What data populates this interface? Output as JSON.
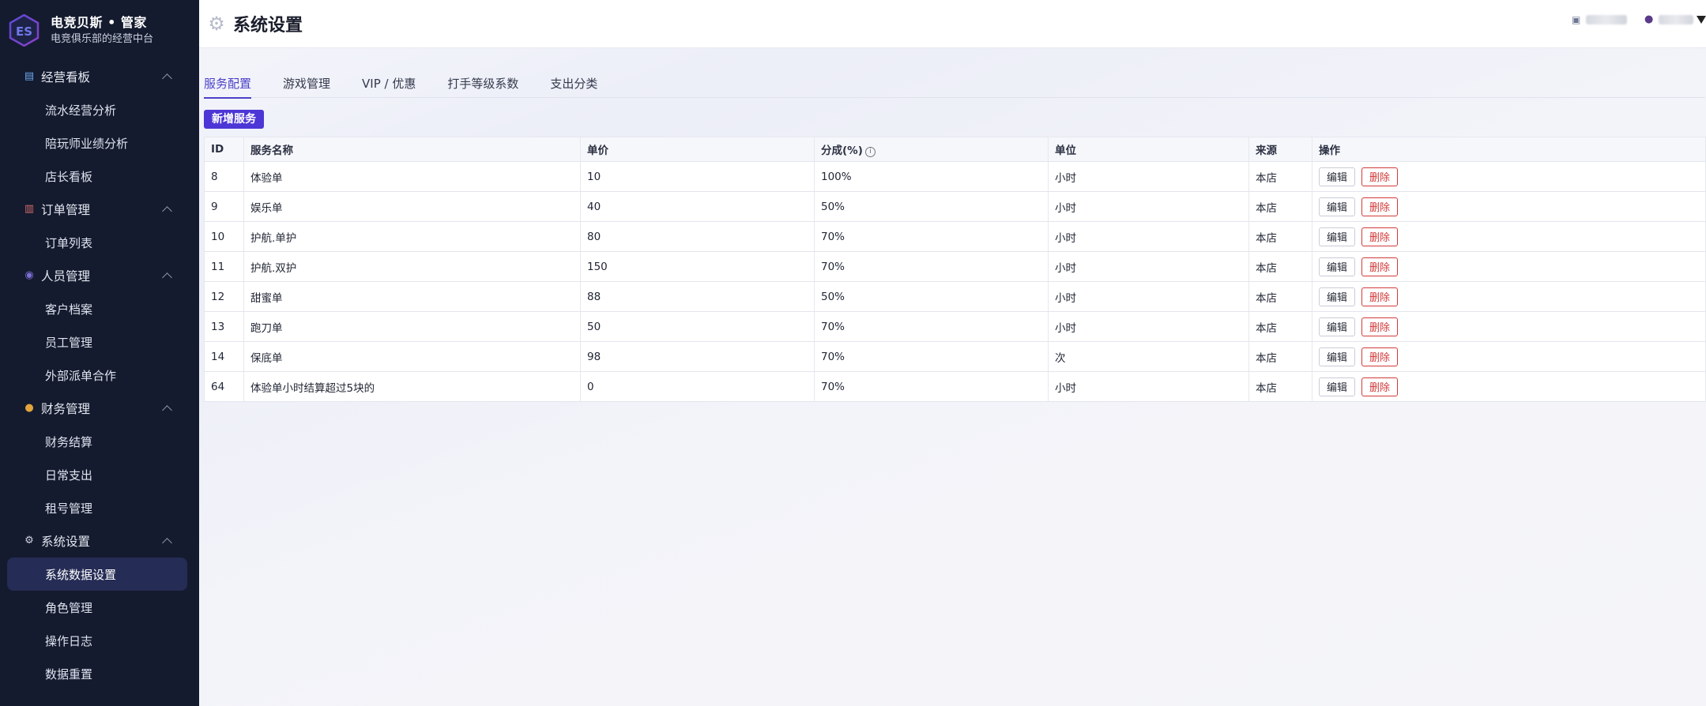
{
  "brand": {
    "logo_text": "ES",
    "title": "电竞贝斯 • 管家",
    "subtitle": "电竞俱乐部的经营中台"
  },
  "sidebar": {
    "groups": [
      {
        "label": "经营看板",
        "icon": "bar-chart-icon",
        "items": [
          "流水经营分析",
          "陪玩师业绩分析",
          "店长看板"
        ]
      },
      {
        "label": "订单管理",
        "icon": "clipboard-icon",
        "items": [
          "订单列表"
        ]
      },
      {
        "label": "人员管理",
        "icon": "people-icon",
        "items": [
          "客户档案",
          "员工管理",
          "外部派单合作"
        ]
      },
      {
        "label": "财务管理",
        "icon": "money-bag-icon",
        "items": [
          "财务结算",
          "日常支出",
          "租号管理"
        ]
      },
      {
        "label": "系统设置",
        "icon": "gear-icon",
        "items": [
          "系统数据设置",
          "角色管理",
          "操作日志",
          "数据重置"
        ]
      }
    ],
    "active_item": "系统数据设置"
  },
  "header": {
    "title": "系统设置"
  },
  "tabs": [
    "服务配置",
    "游戏管理",
    "VIP / 优惠",
    "打手等级系数",
    "支出分类"
  ],
  "active_tab": "服务配置",
  "toolbar": {
    "add_label": "新增服务"
  },
  "table": {
    "columns": [
      "ID",
      "服务名称",
      "单价",
      "分成(%)",
      "单位",
      "来源",
      "操作"
    ],
    "info_glyph": "i",
    "rows": [
      {
        "id": "8",
        "name": "体验单",
        "price": "10",
        "share": "100%",
        "unit": "小时",
        "source": "本店"
      },
      {
        "id": "9",
        "name": "娱乐单",
        "price": "40",
        "share": "50%",
        "unit": "小时",
        "source": "本店"
      },
      {
        "id": "10",
        "name": "护航.单护",
        "price": "80",
        "share": "70%",
        "unit": "小时",
        "source": "本店"
      },
      {
        "id": "11",
        "name": "护航.双护",
        "price": "150",
        "share": "70%",
        "unit": "小时",
        "source": "本店"
      },
      {
        "id": "12",
        "name": "甜蜜单",
        "price": "88",
        "share": "50%",
        "unit": "小时",
        "source": "本店"
      },
      {
        "id": "13",
        "name": "跑刀单",
        "price": "50",
        "share": "70%",
        "unit": "小时",
        "source": "本店"
      },
      {
        "id": "14",
        "name": "保底单",
        "price": "98",
        "share": "70%",
        "unit": "次",
        "source": "本店"
      },
      {
        "id": "64",
        "name": "体验单小时结算超过5块的",
        "price": "0",
        "share": "70%",
        "unit": "小时",
        "source": "本店"
      }
    ],
    "edit_label": "编辑",
    "delete_label": "删除"
  },
  "colors": {
    "sidebar_bg": "#141b2e",
    "accent": "#4c36d6",
    "danger": "#d13a3a"
  }
}
